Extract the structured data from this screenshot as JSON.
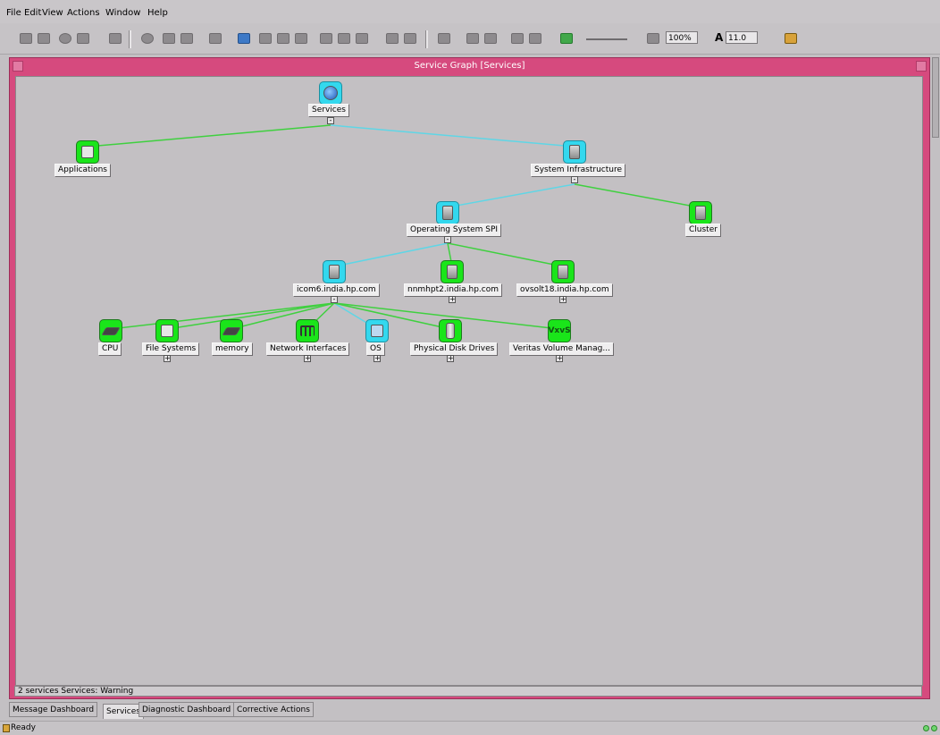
{
  "menu": [
    "File",
    "Edit",
    "View",
    "Actions",
    "Window",
    "Help"
  ],
  "toolbar": {
    "zoom_value": "100%",
    "font_size_value": "11.0",
    "font_glyph": "A"
  },
  "window": {
    "title": "Service Graph [Services]"
  },
  "graph": {
    "root": {
      "label": "Services",
      "expander": "-"
    },
    "applications": {
      "label": "Applications"
    },
    "system_infrastructure": {
      "label": "System Infrastructure",
      "expander": "-"
    },
    "operating_system_spi": {
      "label": "Operating System SPI",
      "expander": "-"
    },
    "cluster": {
      "label": "Cluster"
    },
    "host1": {
      "label": "icom6.india.hp.com",
      "expander": "-"
    },
    "host2": {
      "label": "nnmhpt2.india.hp.com",
      "expander": "+"
    },
    "host3": {
      "label": "ovsolt18.india.hp.com",
      "expander": "+"
    },
    "cpu": {
      "label": "CPU"
    },
    "file_systems": {
      "label": "File Systems",
      "expander": "+"
    },
    "memory": {
      "label": "memory"
    },
    "network_interfaces": {
      "label": "Network Interfaces",
      "expander": "+"
    },
    "os": {
      "label": "OS",
      "expander": "+"
    },
    "physical_disk_drives": {
      "label": "Physical Disk Drives",
      "expander": "+"
    },
    "veritas": {
      "label": "Veritas Volume Manag...",
      "expander": "+",
      "icon_text": "VxvS"
    }
  },
  "status_line": "2 services  Services: Warning",
  "tabs": [
    "Message Dashboard",
    "Services",
    "Diagnostic Dashboard",
    "Corrective Actions"
  ],
  "active_tab": "Services",
  "statusbar": {
    "text": "Ready"
  },
  "colors": {
    "title_bar": "#d64a7e",
    "node_green": "#1ae51a",
    "node_cyan": "#33d8ee",
    "edge_green": "#3fd03f",
    "edge_cyan": "#5fd6e6"
  }
}
